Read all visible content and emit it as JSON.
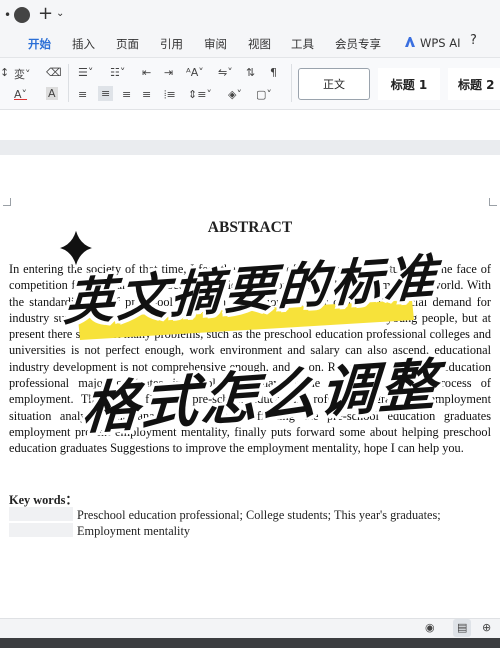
{
  "titlebar": {
    "new_tab_icon": "plus-icon",
    "menu_icon": "chevron-down-icon"
  },
  "menu": {
    "tabs": [
      "开始",
      "插入",
      "页面",
      "引用",
      "审阅",
      "视图",
      "工具",
      "会员专享"
    ],
    "active": "开始",
    "wps_ai": "WPS AI"
  },
  "ribbon": {
    "styles": {
      "normal": "正文",
      "heading1": "标题 1",
      "heading2": "标题 2"
    }
  },
  "document": {
    "title": "ABSTRACT",
    "body": "In entering the society of that time, I feel the all kinds of situations of the student in the face of competition for jobs, and the process of society development is also the same in the world. With the standardization of preschool education professional in our country, the social demand for industry support, the professional talent market is in urgent need of these young people, but at present there still exist many problems, such as the preschool education professional colleges and universities is not perfect enough, work environment and salary can also ascend, educational industry development is not comprehensive enough, and so on. Resulting in preschool education professional major graduates in employment have some difficulties in the process of employment. This paper first on pre-school education professional graduates employment situation analysis, and analysis the factors affecting the pre-school education graduates employment present employment mentality, finally puts forward some about helping preschool education graduates Suggestions to improve the employment mentality, hope I can help you.",
    "keywords_label": "Key words：",
    "keywords_line1": "Preschool education professional; College students; This year's graduates;",
    "keywords_line2": "Employment mentality"
  },
  "overlay": {
    "headline_line1": "英文摘要的标准",
    "headline_line2": "格式怎么调整"
  },
  "colors": {
    "accent": "#2b6fd6",
    "highlight": "#f7e23a"
  }
}
